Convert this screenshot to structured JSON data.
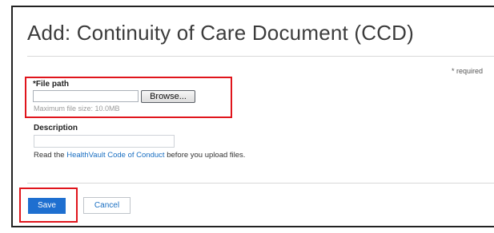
{
  "header": {
    "title": "Add: Continuity of Care Document (CCD)"
  },
  "form": {
    "required_note": "* required",
    "file_path": {
      "label": "*File path",
      "value": "",
      "browse_label": "Browse...",
      "hint": "Maximum file size: 10.0MB"
    },
    "description": {
      "label": "Description",
      "value": ""
    },
    "conduct": {
      "prefix": "Read the ",
      "link": "HealthVault Code of Conduct",
      "suffix": " before you upload files."
    }
  },
  "actions": {
    "save_label": "Save",
    "cancel_label": "Cancel"
  },
  "colors": {
    "highlight": "#e0151c",
    "primary_button": "#1e6fd0",
    "link": "#1a6fc2"
  }
}
